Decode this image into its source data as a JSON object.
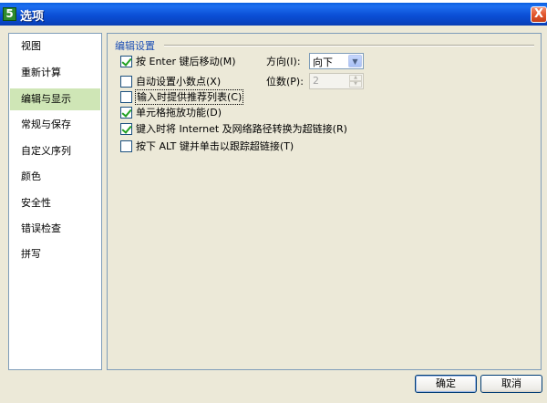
{
  "window": {
    "title": "选项",
    "app_icon": "5",
    "close": "X"
  },
  "sidebar": {
    "selected_index": 2,
    "items": [
      {
        "label": "视图"
      },
      {
        "label": "重新计算"
      },
      {
        "label": "编辑与显示"
      },
      {
        "label": "常规与保存"
      },
      {
        "label": "自定义序列"
      },
      {
        "label": "颜色"
      },
      {
        "label": "安全性"
      },
      {
        "label": "错误检查"
      },
      {
        "label": "拼写"
      }
    ]
  },
  "edit_settings": {
    "section_title": "编辑设置",
    "options": [
      {
        "label": "按 Enter 键后移动(M)",
        "checked": true
      },
      {
        "label": "自动设置小数点(X)",
        "checked": false
      },
      {
        "label": "输入时提供推荐列表(C)",
        "checked": false
      },
      {
        "label": "单元格拖放功能(D)",
        "checked": true
      },
      {
        "label": "键入时将 Internet 及网络路径转换为超链接(R)",
        "checked": true
      },
      {
        "label": "按下 ALT 键并单击以跟踪超链接(T)",
        "checked": false
      }
    ],
    "direction": {
      "label": "方向(I):",
      "value": "向下"
    },
    "places": {
      "label": "位数(P):",
      "value": "2"
    }
  },
  "buttons": {
    "ok": "确定",
    "cancel": "取消"
  }
}
